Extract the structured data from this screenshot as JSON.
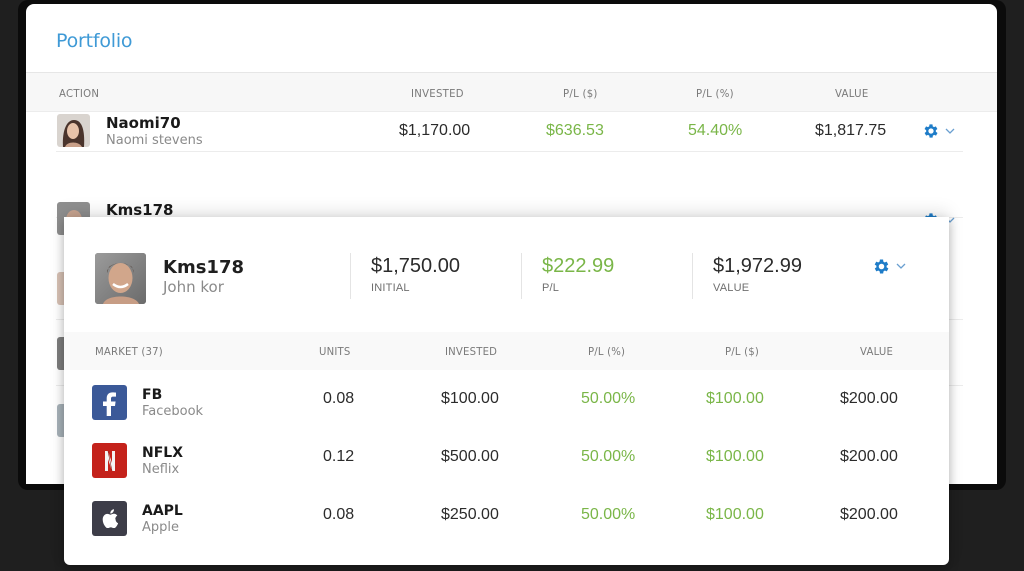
{
  "portfolio": {
    "title": "Portfolio",
    "columns": [
      "ACTION",
      "INVESTED",
      "P/L ($)",
      "P/L (%)",
      "VALUE"
    ],
    "rows": [
      {
        "username": "Naomi70",
        "full_name": "Naomi stevens",
        "invested": "$1,170.00",
        "pl_dollar": "$636.53",
        "pl_percent": "54.40%",
        "value": "$1,817.75"
      },
      {
        "username": "Kms178"
      }
    ]
  },
  "popup": {
    "username": "Kms178",
    "full_name": "John kor",
    "stats": [
      {
        "value": "$1,750.00",
        "label": "INITIAL"
      },
      {
        "value": "$222.99",
        "label": "P/L"
      },
      {
        "value": "$1,972.99",
        "label": "VALUE"
      }
    ],
    "market_columns": [
      "MARKET (37)",
      "UNITS",
      "INVESTED",
      "P/L (%)",
      "P/L ($)",
      "VALUE"
    ],
    "markets": [
      {
        "symbol": "FB",
        "name": "Facebook",
        "icon": "facebook-logo",
        "units": "0.08",
        "invested": "$100.00",
        "pl_percent": "50.00%",
        "pl_dollar": "$100.00",
        "value": "$200.00"
      },
      {
        "symbol": "NFLX",
        "name": "Neflix",
        "icon": "netflix-logo",
        "units": "0.12",
        "invested": "$500.00",
        "pl_percent": "50.00%",
        "pl_dollar": "$100.00",
        "value": "$200.00"
      },
      {
        "symbol": "AAPL",
        "name": "Apple",
        "icon": "apple-logo",
        "units": "0.08",
        "invested": "$250.00",
        "pl_percent": "50.00%",
        "pl_dollar": "$100.00",
        "value": "$200.00"
      }
    ]
  },
  "icons": {
    "settings": "gear-icon",
    "expand": "chevron-down-icon"
  },
  "colors": {
    "accent": "#3f9ad6",
    "gear": "#1e7cc8",
    "positive": "#7ab648",
    "facebook": "#3b5998",
    "netflix": "#c4221b",
    "apple": "#3d3d48"
  }
}
